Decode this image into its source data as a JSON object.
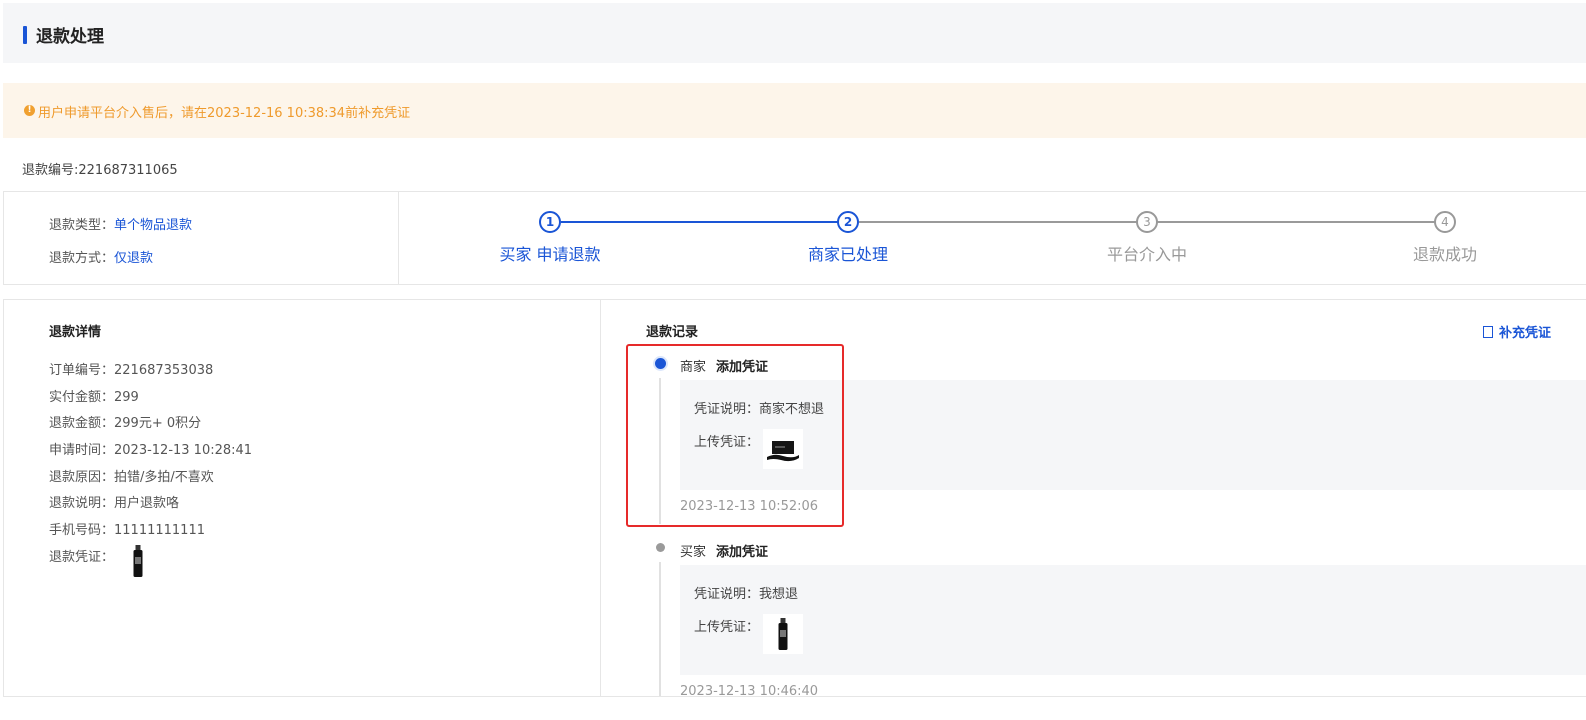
{
  "header": {
    "title": "退款处理"
  },
  "notice": {
    "icon": "warning-icon",
    "text": "用户申请平台介入售后，请在2023-12-16 10:38:34前补充凭证"
  },
  "refund_no": "退款编号:221687311065",
  "summary": {
    "type_label": "退款类型：",
    "type_value": "单个物品退款",
    "method_label": "退款方式：",
    "method_value": "仅退款"
  },
  "steps": [
    {
      "num": "1",
      "label": "买家 申请退款",
      "active": true
    },
    {
      "num": "2",
      "label": "商家已处理",
      "active": true
    },
    {
      "num": "3",
      "label": "平台介入中",
      "active": false
    },
    {
      "num": "4",
      "label": "退款成功",
      "active": false
    }
  ],
  "details": {
    "title": "退款详情",
    "rows": [
      "订单编号：221687353038",
      "实付金额：299",
      "退款金额：299元+ 0积分",
      "申请时间：2023-12-13 10:28:41",
      "退款原因：拍错/多拍/不喜欢",
      "退款说明：用户退款咯",
      "手机号码：11111111111",
      "退款凭证："
    ]
  },
  "records": {
    "title": "退款记录",
    "add_button": "补充凭证",
    "items": [
      {
        "role": "商家",
        "action": "添加凭证",
        "desc": "凭证说明：商家不想退",
        "upload_label": "上传凭证：",
        "time": "2023-12-13 10:52:06",
        "thumb": "hat-thumbnail"
      },
      {
        "role": "买家",
        "action": "添加凭证",
        "desc": "凭证说明：我想退",
        "upload_label": "上传凭证：",
        "time": "2023-12-13 10:46:40",
        "thumb": "bottle-thumbnail"
      }
    ]
  },
  "colors": {
    "accent": "#1a55d6",
    "warning": "#ef9a2c",
    "highlight": "#e62a2a"
  }
}
